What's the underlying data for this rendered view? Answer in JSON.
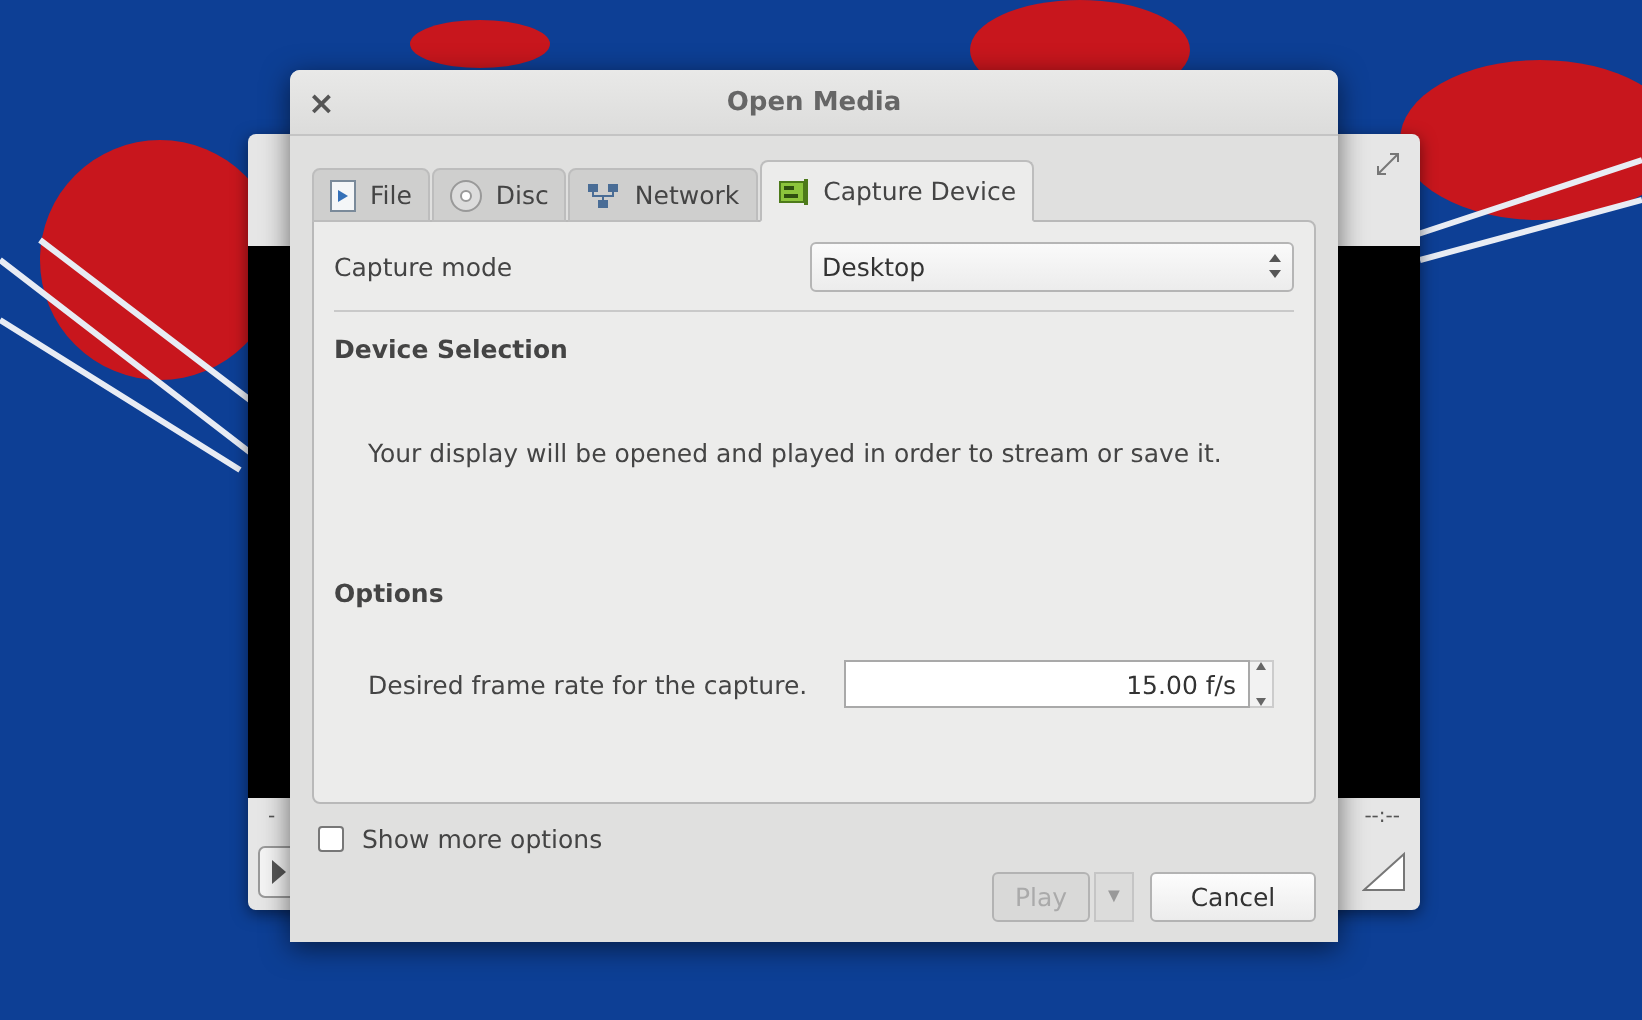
{
  "background_window": {
    "elapsed": "-",
    "time": "--:--"
  },
  "dialog": {
    "title": "Open Media",
    "close": "×"
  },
  "tabs": [
    {
      "label": "File",
      "selected": false
    },
    {
      "label": "Disc",
      "selected": false
    },
    {
      "label": "Network",
      "selected": false
    },
    {
      "label": "Capture Device",
      "selected": true
    }
  ],
  "capture_mode": {
    "label": "Capture mode",
    "value": "Desktop"
  },
  "device_selection": {
    "heading": "Device Selection",
    "message": "Your display will be opened and played in order to stream or save it."
  },
  "options": {
    "heading": "Options",
    "frame_rate_label": "Desired frame rate for the capture.",
    "frame_rate_value": "15.00 f/s"
  },
  "show_more_options": {
    "label": "Show more options",
    "checked": false
  },
  "buttons": [
    {
      "label": "Play",
      "kind": "split",
      "dropdown": "▼",
      "disabled": true
    },
    {
      "label": "Cancel",
      "kind": "plain",
      "disabled": false
    }
  ]
}
